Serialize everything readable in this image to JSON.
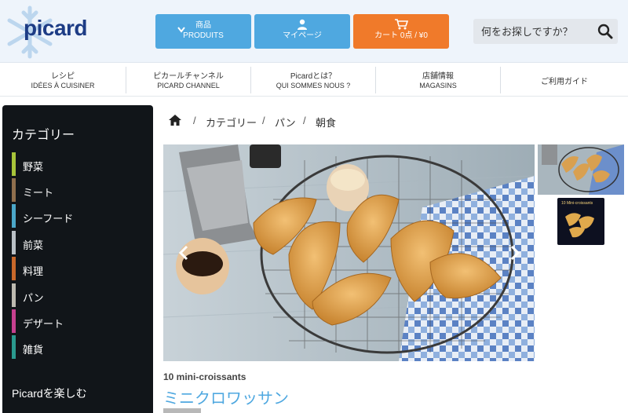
{
  "header": {
    "logo_text": "picard",
    "products": {
      "top": "商品",
      "bottom": "PRODUITS"
    },
    "mypage": {
      "label": "マイページ"
    },
    "cart": {
      "label": "カート 0点 / ¥0"
    },
    "search": {
      "placeholder": "何をお探しですか？"
    }
  },
  "nav": {
    "items": [
      {
        "jp": "レシピ",
        "fr": "IDÉES À CUISINER"
      },
      {
        "jp": "ピカールチャンネル",
        "fr": "PICARD CHANNEL"
      },
      {
        "jp": "Picardとは？",
        "fr": "QUI SOMMES NOUS ?"
      },
      {
        "jp": "店舗情報",
        "fr": "MAGASINS"
      },
      {
        "jp": "ご利用ガイド",
        "fr": ""
      }
    ]
  },
  "sidebar": {
    "title": "カテゴリー",
    "items": [
      {
        "label": "野菜",
        "color": "#a8c43a"
      },
      {
        "label": "ミート",
        "color": "#8f6f4d"
      },
      {
        "label": "シーフード",
        "color": "#4ba7c9"
      },
      {
        "label": "前菜",
        "color": "#b9c0c6"
      },
      {
        "label": "料理",
        "color": "#c8682a"
      },
      {
        "label": "パン",
        "color": "#bdbab0"
      },
      {
        "label": "デザート",
        "color": "#c6408f"
      },
      {
        "label": "雑貨",
        "color": "#2a9a8e"
      }
    ],
    "footer": "Picardを楽しむ"
  },
  "breadcrumb": {
    "items": [
      "カテゴリー",
      "パン",
      "朝食"
    ]
  },
  "product": {
    "subtitle": "10 mini-croissants",
    "title": "ミニクロワッサン",
    "thumb2_label": "10 Mini-croissants"
  },
  "colors": {
    "accent_blue": "#4fa8e0",
    "cart_orange": "#f07a2a",
    "sidebar_bg": "#111519",
    "brand_navy": "#1d3c85"
  }
}
